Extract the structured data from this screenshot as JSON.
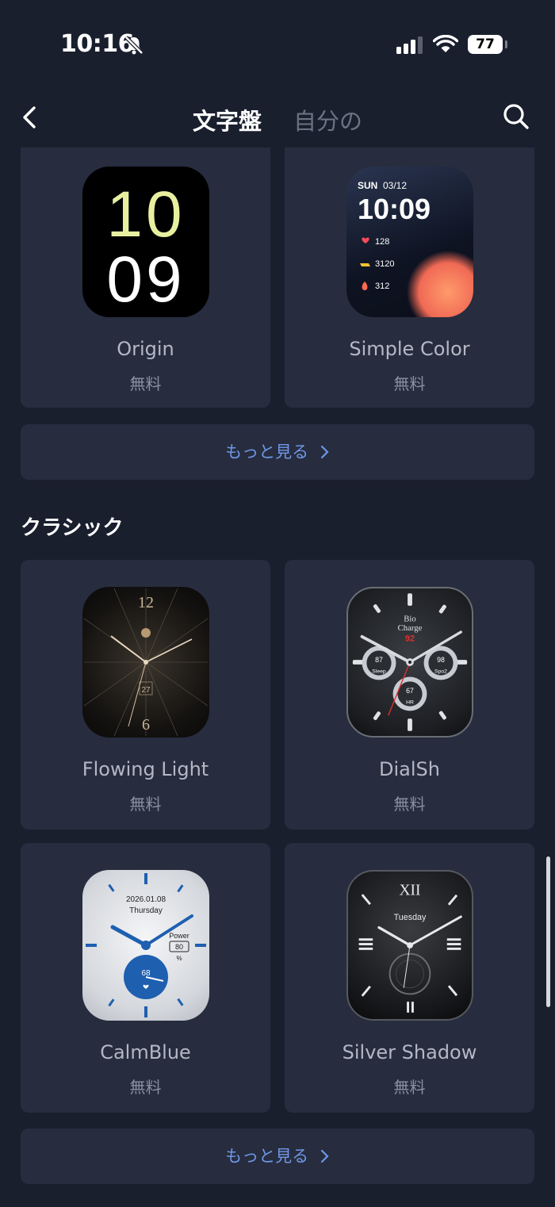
{
  "status": {
    "time": "10:16",
    "battery": "77"
  },
  "nav": {
    "tab_active": "文字盤",
    "tab_inactive": "自分の"
  },
  "top_cards": [
    {
      "name": "Origin",
      "price": "無料",
      "face": {
        "hour": "10",
        "minute": "09"
      }
    },
    {
      "name": "Simple Color",
      "price": "無料",
      "face": {
        "day": "SUN",
        "date": "03/12",
        "time": "10:09",
        "heart": "128",
        "steps": "3120",
        "calories": "312"
      }
    }
  ],
  "more_label": "もっと見る",
  "section": {
    "title": "クラシック"
  },
  "classic_cards": [
    {
      "name": "Flowing Light",
      "price": "無料",
      "face": {
        "n12": "12",
        "n6": "6",
        "date": "27"
      }
    },
    {
      "name": "DialSh",
      "price": "無料",
      "face": {
        "bio": "Bio",
        "charge": "Charge",
        "value": "92",
        "sleep": "87",
        "sleep_label": "Sleep",
        "spo2": "98",
        "spo2_label": "Spo2",
        "hr": "67",
        "hr_label": "HR"
      }
    },
    {
      "name": "CalmBlue",
      "price": "無料",
      "face": {
        "date": "2026.01.08",
        "weekday": "Thursday",
        "power_label": "Power",
        "power": "80",
        "unit": "%",
        "hr": "68"
      }
    },
    {
      "name": "Silver Shadow",
      "price": "無料",
      "face": {
        "weekday": "Tuesday",
        "xii": "XII"
      }
    }
  ],
  "colors": {
    "background": "#1a1f2e",
    "card": "#272d3f",
    "link": "#6f97e8",
    "accent_yellow": "#e8f0a0"
  }
}
